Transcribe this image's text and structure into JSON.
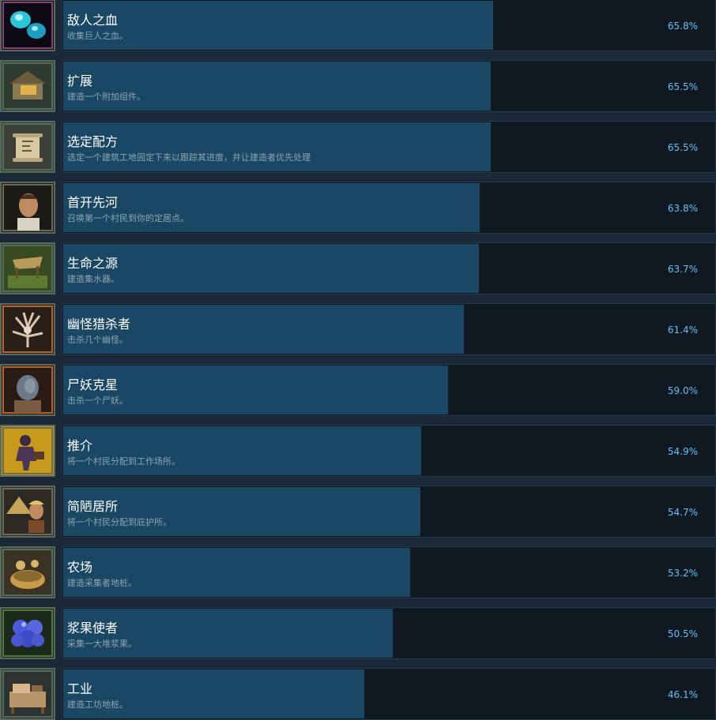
{
  "achievements": [
    {
      "name": "敌人之血",
      "description": "收集巨人之血。",
      "percent_label": "65.8%",
      "percent": 65.8,
      "icon": "blue-gems-icon",
      "frame_color": "#8a3f7a"
    },
    {
      "name": "扩展",
      "description": "建造一个附加组件。",
      "percent_label": "65.5%",
      "percent": 65.5,
      "icon": "building-addon-icon",
      "frame_color": "#4f6e63"
    },
    {
      "name": "选定配方",
      "description": "选定一个建筑工地固定下来以跟踪其进度，并让建造者优先处理",
      "percent_label": "65.5%",
      "percent": 65.5,
      "icon": "scroll-recipe-icon",
      "frame_color": "#4f6e63"
    },
    {
      "name": "首开先河",
      "description": "召唤第一个村民到你的定居点。",
      "percent_label": "63.8%",
      "percent": 63.8,
      "icon": "villager-portrait-icon",
      "frame_color": "#6a6a58"
    },
    {
      "name": "生命之源",
      "description": "建造集水器。",
      "percent_label": "63.7%",
      "percent": 63.7,
      "icon": "water-collector-icon",
      "frame_color": "#4f6e63"
    },
    {
      "name": "幽怪猎杀者",
      "description": "击杀几个幽怪。",
      "percent_label": "61.4%",
      "percent": 61.4,
      "icon": "root-creature-icon",
      "frame_color": "#b0642c"
    },
    {
      "name": "尸妖克星",
      "description": "击杀一个尸妖。",
      "percent_label": "59.0%",
      "percent": 59.0,
      "icon": "ghoul-face-icon",
      "frame_color": "#b0642c"
    },
    {
      "name": "推介",
      "description": "将一个村民分配到工作场所。",
      "percent_label": "54.9%",
      "percent": 54.9,
      "icon": "worker-assign-icon",
      "frame_color": "#6a6a58"
    },
    {
      "name": "简陋居所",
      "description": "将一个村民分配到庇护所。",
      "percent_label": "54.7%",
      "percent": 54.7,
      "icon": "shelter-villager-icon",
      "frame_color": "#6a6a58"
    },
    {
      "name": "农场",
      "description": "建造采集者地桩。",
      "percent_label": "53.2%",
      "percent": 53.2,
      "icon": "farm-basket-icon",
      "frame_color": "#4f6e63"
    },
    {
      "name": "浆果使者",
      "description": "采集一大堆浆果。",
      "percent_label": "50.5%",
      "percent": 50.5,
      "icon": "berries-icon",
      "frame_color": "#4f7a3c"
    },
    {
      "name": "工业",
      "description": "建造工坊地桩。",
      "percent_label": "46.1%",
      "percent": 46.1,
      "icon": "workshop-icon",
      "frame_color": "#4f6e63"
    }
  ]
}
